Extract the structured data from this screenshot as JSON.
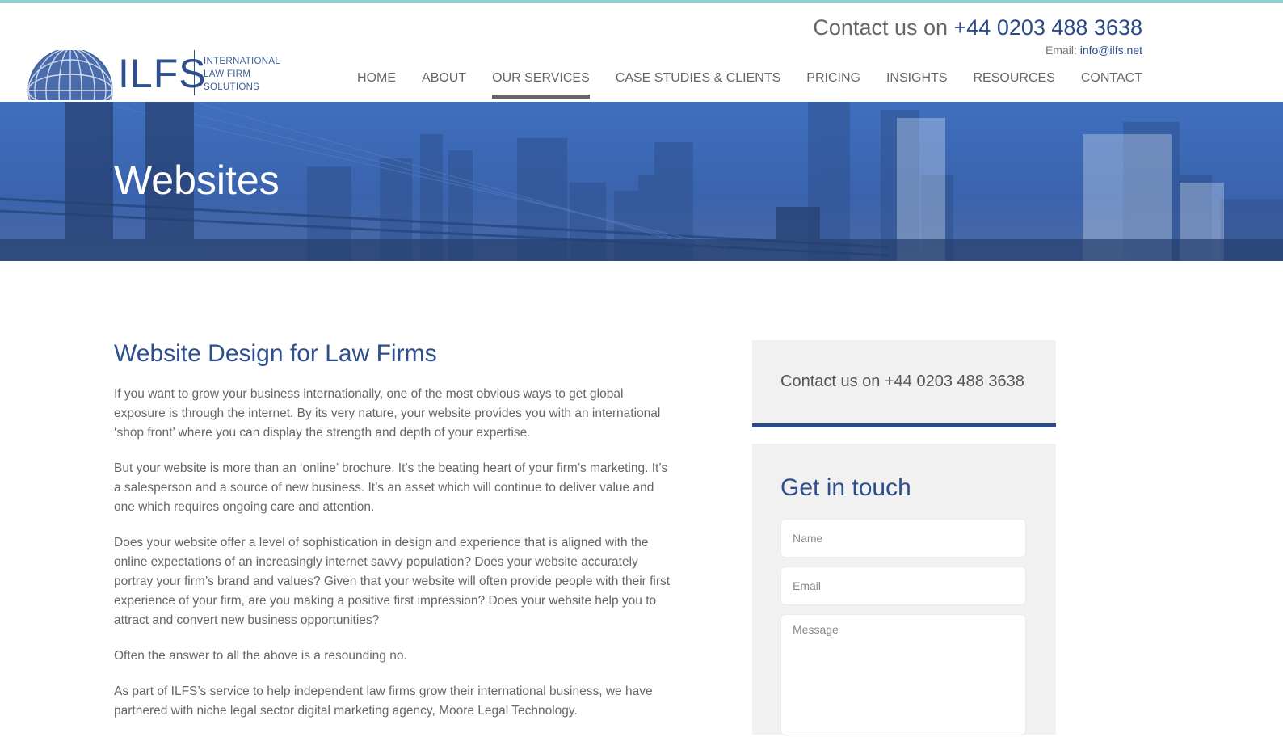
{
  "header": {
    "contact_prefix": "Contact us on ",
    "phone": "+44 0203 488 3638",
    "email_label": "Email: ",
    "email": "info@ilfs.net",
    "logo": {
      "mark": "ILFS",
      "line1": "INTERNATIONAL",
      "line2": "LAW FIRM",
      "line3": "SOLUTIONS"
    }
  },
  "nav": {
    "items": [
      {
        "label": "HOME"
      },
      {
        "label": "ABOUT"
      },
      {
        "label": "OUR SERVICES",
        "active": true
      },
      {
        "label": "CASE STUDIES & CLIENTS"
      },
      {
        "label": "PRICING"
      },
      {
        "label": "INSIGHTS"
      },
      {
        "label": "RESOURCES"
      },
      {
        "label": "CONTACT"
      }
    ]
  },
  "hero": {
    "title": "Websites"
  },
  "main": {
    "heading": "Website Design for Law Firms",
    "paragraphs": [
      "If you want to grow your business internationally, one of the most obvious ways to get global exposure is through the internet. By its very nature, your website provides you with an international ‘shop front’ where you can display the strength and depth of your expertise.",
      "But your website is more than an ‘online’ brochure. It’s the beating heart of your firm’s marketing. It’s a salesperson and a source of new business. It’s an asset which will continue to deliver value and one which requires ongoing care and attention.",
      "Does your website offer a level of sophistication in design and experience that is aligned with the online expectations of an increasingly internet savvy population? Does your website accurately portray your firm’s brand and values? Given that your website will often provide people with their first experience of your firm, are you making a positive first impression? Does your website help you to attract and convert new business opportunities?",
      "Often the answer to all the above is a resounding no.",
      "As part of ILFS’s service to help independent law firms grow their international business, we have partnered with niche legal sector digital marketing agency, Moore Legal Technology."
    ]
  },
  "sidebar": {
    "contact_text": "Contact us on +44 0203 488 3638",
    "form": {
      "title": "Get in touch",
      "name_placeholder": "Name",
      "email_placeholder": "Email",
      "message_placeholder": "Message"
    }
  },
  "colors": {
    "brand_blue": "#2a4a8a",
    "heading_blue": "#2e4f8d",
    "top_strip": "#8fcfcf",
    "hero_blue": "#3f6fbe"
  }
}
